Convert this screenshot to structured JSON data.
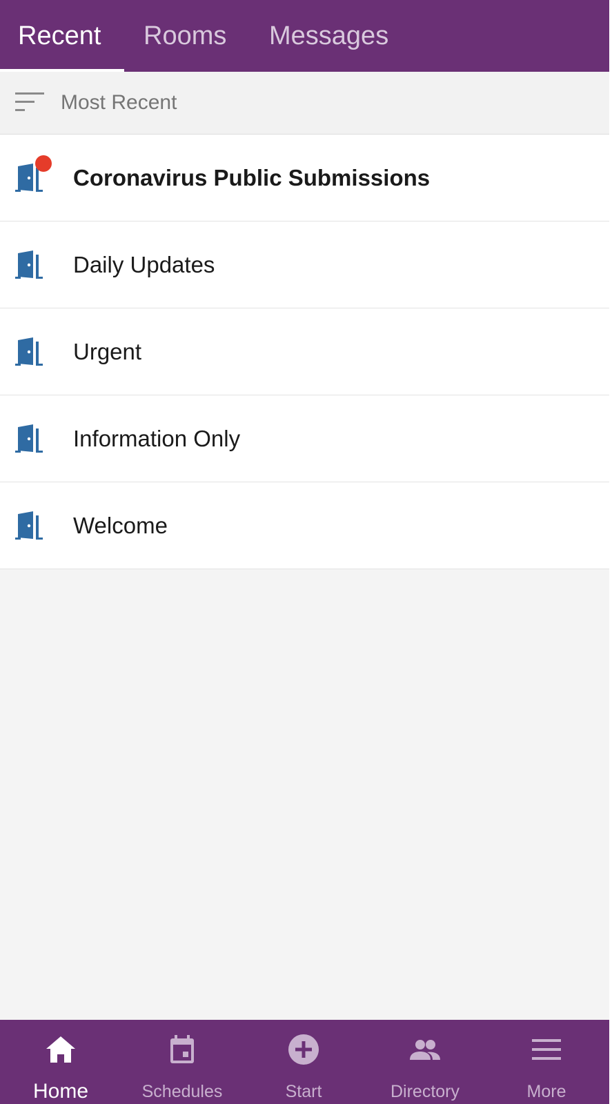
{
  "tabs": [
    {
      "label": "Recent",
      "active": true
    },
    {
      "label": "Rooms",
      "active": false
    },
    {
      "label": "Messages",
      "active": false
    }
  ],
  "sort": {
    "icon": "sort-icon",
    "label": "Most Recent"
  },
  "rooms": [
    {
      "name": "Coronavirus Public Submissions",
      "icon": "door-icon",
      "unread": true
    },
    {
      "name": "Daily Updates",
      "icon": "door-icon",
      "unread": false
    },
    {
      "name": "Urgent",
      "icon": "door-icon",
      "unread": false
    },
    {
      "name": "Information Only",
      "icon": "door-icon",
      "unread": false
    },
    {
      "name": "Welcome",
      "icon": "door-icon",
      "unread": false
    }
  ],
  "bottom_nav": [
    {
      "label": "Home",
      "icon": "home-icon",
      "active": true
    },
    {
      "label": "Schedules",
      "icon": "calendar-icon",
      "active": false
    },
    {
      "label": "Start",
      "icon": "add-circle-icon",
      "active": false
    },
    {
      "label": "Directory",
      "icon": "people-icon",
      "active": false
    },
    {
      "label": "More",
      "icon": "menu-icon",
      "active": false
    }
  ],
  "colors": {
    "header": "#6a3075",
    "door_icon": "#2f6ba3",
    "unread_dot": "#e53c2a",
    "background": "#f4f4f4"
  }
}
